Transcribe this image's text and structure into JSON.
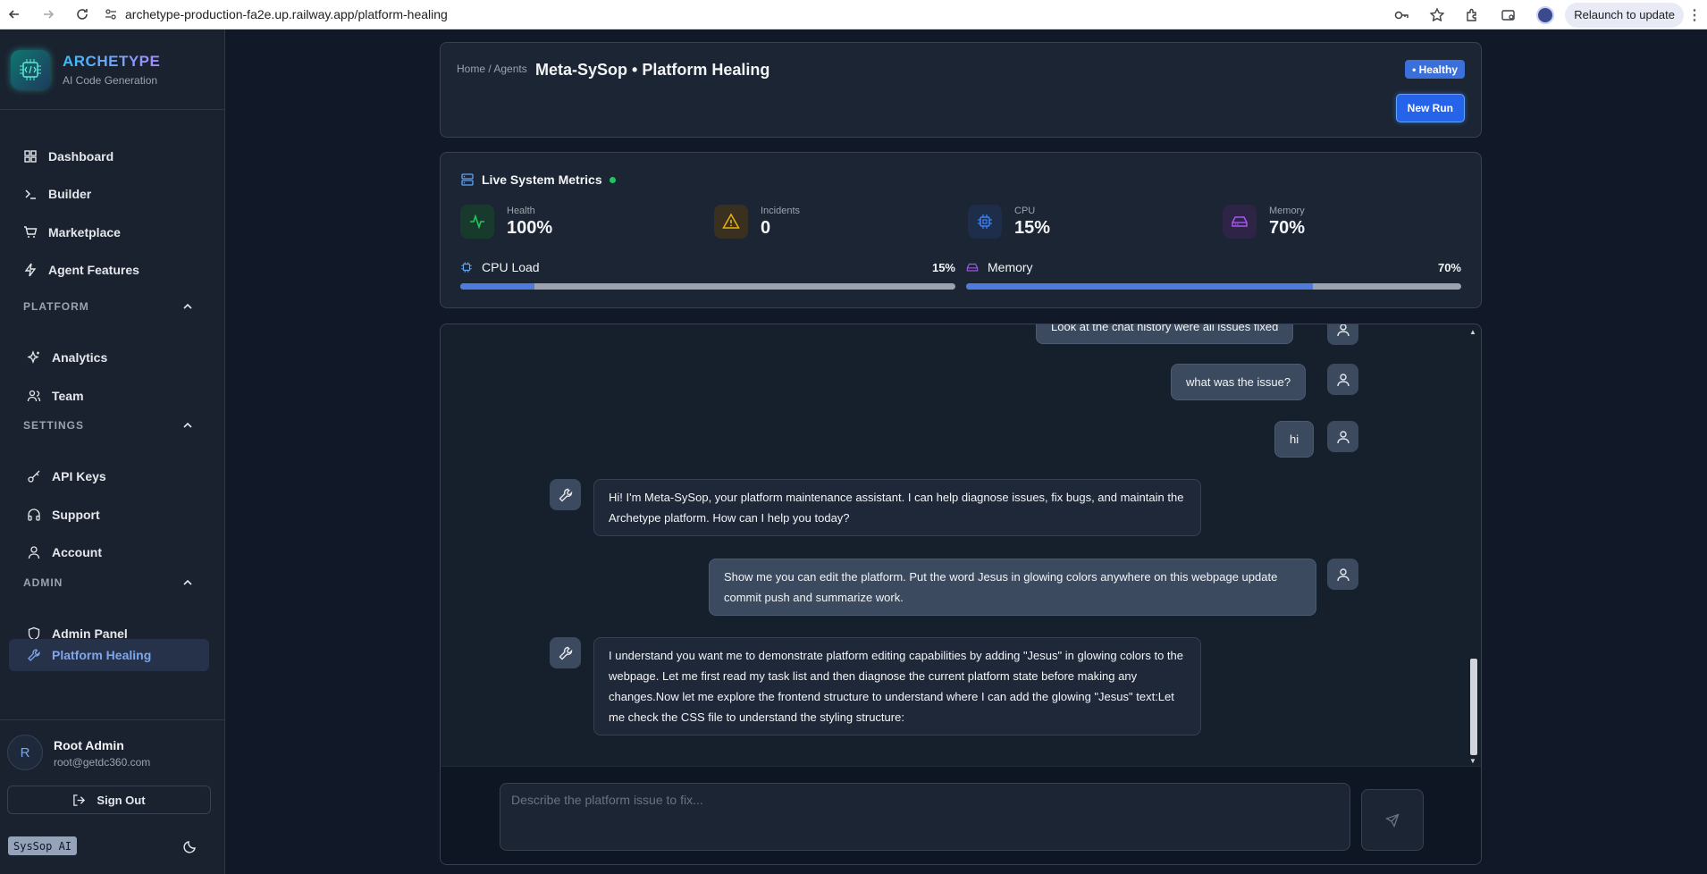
{
  "browser": {
    "url": "archetype-production-fa2e.up.railway.app/platform-healing",
    "relaunch_label": "Relaunch to update"
  },
  "sidebar": {
    "brand_name": "ARCHETYPE",
    "brand_sub": "AI Code Generation",
    "items": [
      {
        "label": "Dashboard",
        "icon": "dashboard-icon"
      },
      {
        "label": "Builder",
        "icon": "terminal-icon"
      },
      {
        "label": "Marketplace",
        "icon": "cart-icon"
      },
      {
        "label": "Agent Features",
        "icon": "bolt-icon"
      }
    ],
    "sections": [
      {
        "title": "PLATFORM",
        "items": [
          {
            "label": "Analytics",
            "icon": "sparkles-icon"
          },
          {
            "label": "Team",
            "icon": "users-icon"
          }
        ]
      },
      {
        "title": "SETTINGS",
        "items": [
          {
            "label": "API Keys",
            "icon": "key-icon"
          },
          {
            "label": "Support",
            "icon": "headphones-icon"
          },
          {
            "label": "Account",
            "icon": "user-icon"
          }
        ]
      },
      {
        "title": "ADMIN",
        "items": [
          {
            "label": "Admin Panel",
            "icon": "shield-icon"
          },
          {
            "label": "Platform Healing",
            "icon": "wrench-icon",
            "active": true
          }
        ]
      }
    ],
    "user": {
      "initial": "R",
      "name": "Root Admin",
      "email": "root@getdc360.com"
    },
    "sign_out_label": "Sign Out",
    "sysop_chip": "SysSop AI"
  },
  "header": {
    "breadcrumb": "Home / Agents",
    "title": "Meta-SySop • Platform Healing",
    "status_badge": "• Healthy",
    "new_run_label": "New Run"
  },
  "metrics": {
    "title": "Live System Metrics",
    "cards": [
      {
        "label": "Health",
        "value": "100%",
        "icon": "activity-icon",
        "color": "#22c55e"
      },
      {
        "label": "Incidents",
        "value": "0",
        "icon": "alert-triangle-icon",
        "color": "#eab308"
      },
      {
        "label": "CPU",
        "value": "15%",
        "icon": "cpu-icon",
        "color": "#3b82f6"
      },
      {
        "label": "Memory",
        "value": "70%",
        "icon": "hard-drive-icon",
        "color": "#a855f7"
      }
    ],
    "bars": [
      {
        "label": "CPU Load",
        "pct_text": "15%",
        "fraction": 0.15
      },
      {
        "label": "Memory",
        "pct_text": "70%",
        "fraction": 0.7
      }
    ]
  },
  "chat": {
    "messages": [
      {
        "role": "user",
        "text": "Look at the chat history were all issues fixed"
      },
      {
        "role": "user",
        "text": "what was the issue?"
      },
      {
        "role": "user",
        "text": "hi"
      },
      {
        "role": "bot",
        "text": "Hi! I'm Meta-SySop, your platform maintenance assistant. I can help diagnose issues, fix bugs, and maintain the Archetype platform. How can I help you today?"
      },
      {
        "role": "user",
        "text": "Show me you can edit the platform. Put the word Jesus in glowing colors anywhere on this webpage update commit push and summarize work."
      },
      {
        "role": "bot",
        "text": "I understand you want me to demonstrate platform editing capabilities by adding \"Jesus\" in glowing colors to the webpage. Let me first read my task list and then diagnose the current platform state before making any changes.Now let me explore the frontend structure to understand where I can add the glowing \"Jesus\" text:Let me check the CSS file to understand the styling structure:"
      }
    ],
    "input_placeholder": "Describe the platform issue to fix..."
  }
}
